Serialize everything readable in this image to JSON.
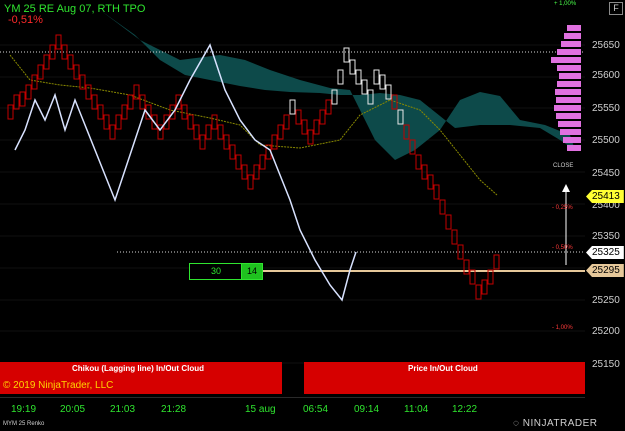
{
  "title": "YM 25 RE Aug 07, RTH TPO",
  "change_pct": "-0,51%",
  "f_button": "F",
  "y_ticks": [
    "25650",
    "25600",
    "25550",
    "25500",
    "25450",
    "25400",
    "25350",
    "25300",
    "25250",
    "25200",
    "25150"
  ],
  "price_tags": {
    "yellow": "25413",
    "white": "25325",
    "tan": "25295"
  },
  "pct_labels": {
    "top": "+ 1,00%",
    "m025": "- 0,25%",
    "m050": "- 0,50%",
    "m100": "- 1,00%",
    "close": "CLOSE"
  },
  "cloud_labels": {
    "chikou": "Chikou (Lagging line) In/Out Cloud",
    "price": "Price In/Out Cloud"
  },
  "copyright": "© 2019 NinjaTrader, LLC",
  "x_ticks": [
    "19:19",
    "20:05",
    "21:03",
    "21:28",
    "15 aug",
    "06:54",
    "09:14",
    "11:04",
    "12:22"
  ],
  "instrument": "MYM 25 Renko",
  "brand": "NINJATRADER",
  "boxes": {
    "left": "30",
    "right": "14"
  },
  "colors": {
    "bg": "#000000",
    "green_text": "#2fe52f",
    "red_text": "#ff2a2a",
    "cloud": "#0d4a4a",
    "bar_red": "#c40000",
    "bar_white": "#e8e8e8",
    "chikou": "#d8e2ff",
    "tenkan": "#8a8a00",
    "profile": "#e070e0",
    "cloud_bar": "#d60000"
  }
}
